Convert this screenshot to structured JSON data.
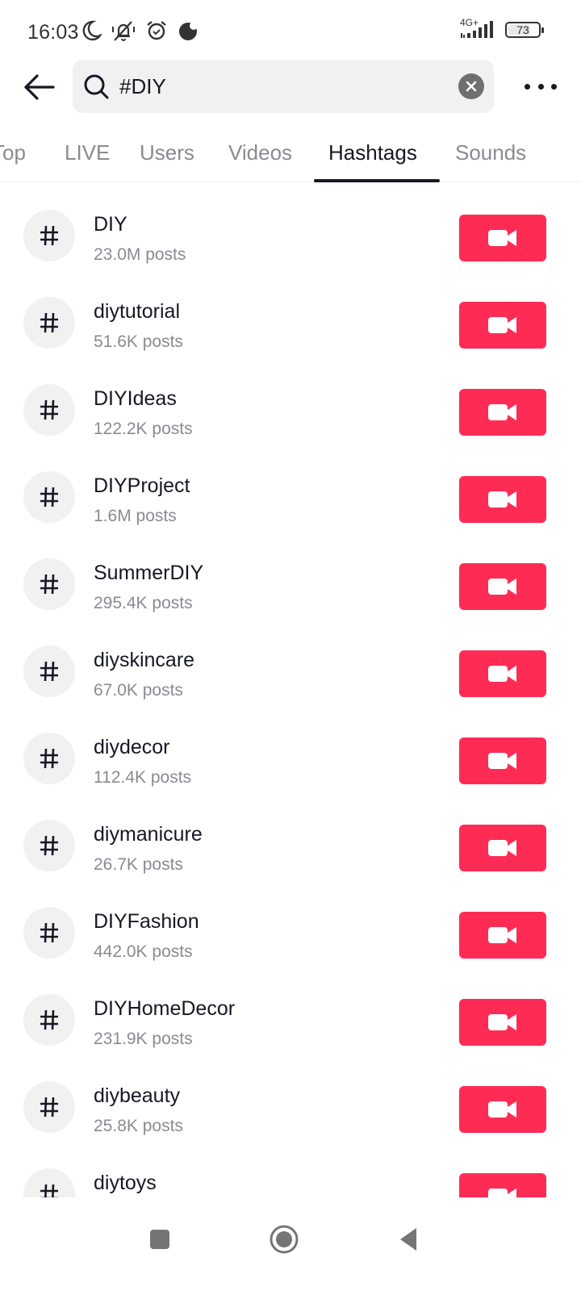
{
  "status_bar": {
    "time": "16:03",
    "icons": [
      "do-not-disturb-moon-icon",
      "vibrate-off-icon",
      "alarm-icon",
      "night-mode-icon"
    ],
    "network_label": "4G+",
    "battery_level": "73",
    "battery_percent": 73
  },
  "search": {
    "query": "#DIY",
    "back_icon": "arrow-left-icon",
    "search_icon": "magnifier-icon",
    "clear_icon": "clear-x-icon",
    "more_icon": "more-horizontal-icon"
  },
  "tabs": [
    {
      "label": "Top",
      "active": false
    },
    {
      "label": "LIVE",
      "active": false
    },
    {
      "label": "Users",
      "active": false
    },
    {
      "label": "Videos",
      "active": false
    },
    {
      "label": "Hashtags",
      "active": true
    },
    {
      "label": "Sounds",
      "active": false
    }
  ],
  "hashtags": [
    {
      "name": "DIY",
      "count": "23.0M posts"
    },
    {
      "name": "diytutorial",
      "count": "51.6K posts"
    },
    {
      "name": "DIYIdeas",
      "count": "122.2K posts"
    },
    {
      "name": "DIYProject",
      "count": "1.6M posts"
    },
    {
      "name": "SummerDIY",
      "count": "295.4K posts"
    },
    {
      "name": "diyskincare",
      "count": "67.0K posts"
    },
    {
      "name": "diydecor",
      "count": "112.4K posts"
    },
    {
      "name": "diymanicure",
      "count": "26.7K posts"
    },
    {
      "name": "DIYFashion",
      "count": "442.0K posts"
    },
    {
      "name": "DIYHomeDecor",
      "count": "231.9K posts"
    },
    {
      "name": "diybeauty",
      "count": "25.8K posts"
    },
    {
      "name": "diytoys",
      "count": ""
    }
  ],
  "colors": {
    "accent": "#fe2c55",
    "text_primary": "#161823",
    "text_secondary": "#8a8b91",
    "icon_bg": "#f1f1f2"
  },
  "nav_bar": {
    "recents_icon": "square-recents-icon",
    "home_icon": "circle-home-icon",
    "back_icon": "triangle-back-icon"
  }
}
